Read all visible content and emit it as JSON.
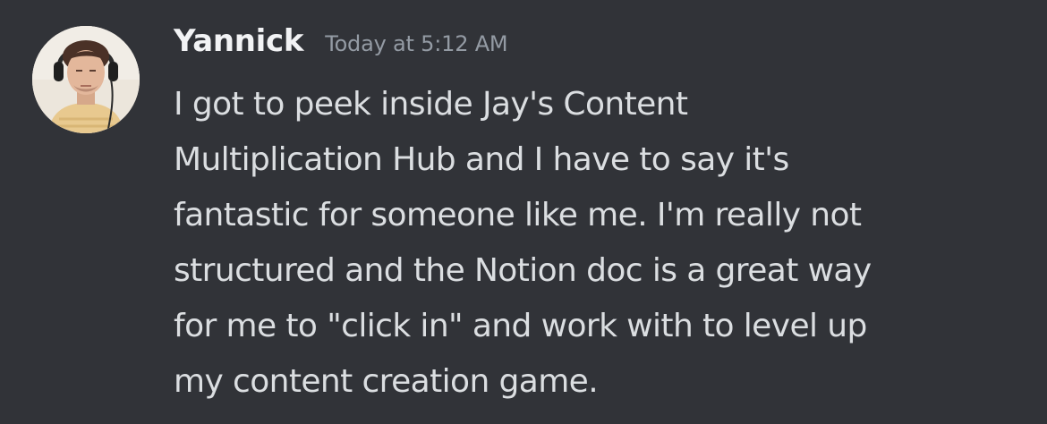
{
  "message": {
    "author": "Yannick",
    "timestamp": "Today at 5:12 AM",
    "text": "I got to peek inside Jay's Content\nMultiplication Hub and I have to say it's\nfantastic for someone like me. I'm really not\nstructured and the Notion doc is a great way\nfor me to \"click in\" and work with to level up\nmy content creation game."
  },
  "colors": {
    "background": "#313338",
    "username": "#f2f3f5",
    "timestamp": "#949ba4",
    "message_text": "#dbdee1"
  }
}
